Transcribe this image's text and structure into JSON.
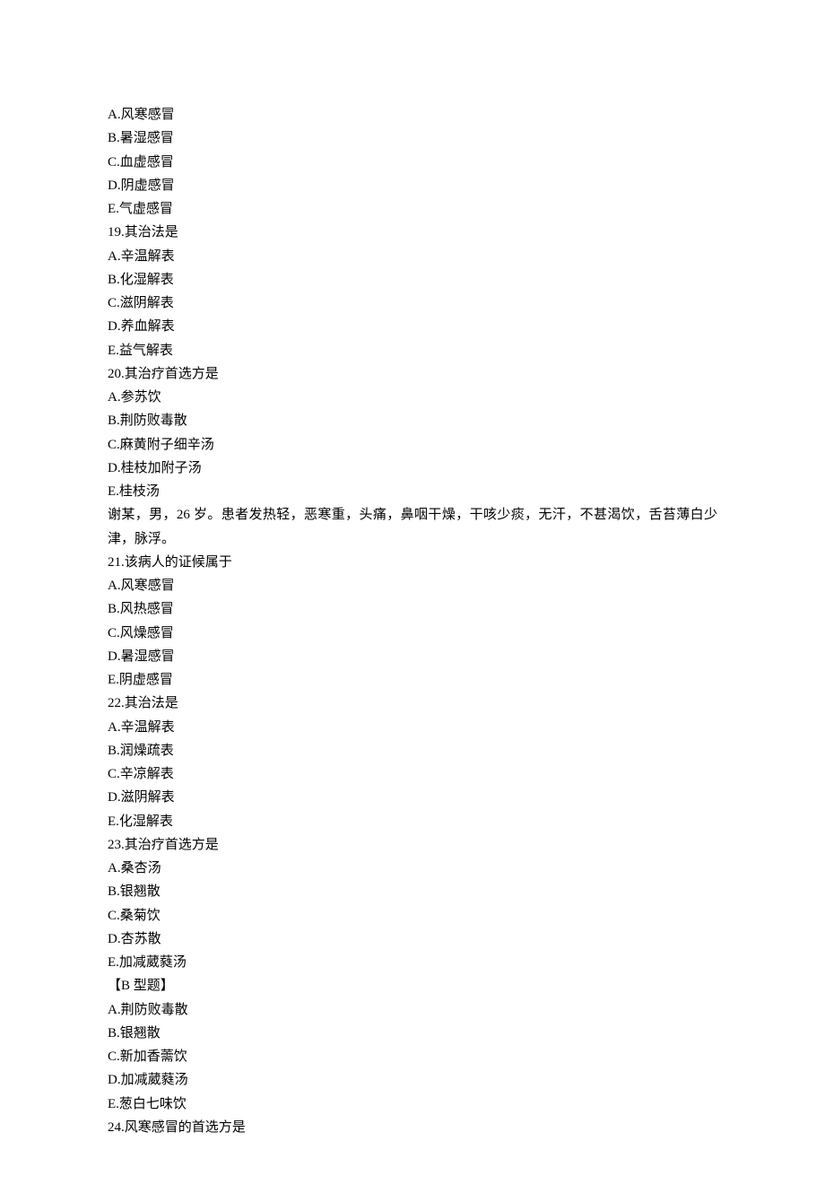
{
  "lines": [
    "A.风寒感冒",
    "B.暑湿感冒",
    "C.血虚感冒",
    "D.阴虚感冒",
    "E.气虚感冒",
    "19.其治法是",
    "A.辛温解表",
    "B.化湿解表",
    "C.滋阴解表",
    "D.养血解表",
    "E.益气解表",
    "20.其治疗首选方是",
    "A.参苏饮",
    "B.荆防败毒散",
    "C.麻黄附子细辛汤",
    "D.桂枝加附子汤",
    "E.桂枝汤",
    "谢某，男，26 岁。患者发热轻，恶寒重，头痛，鼻咽干燥，干咳少痰，无汗，不甚渴饮，舌苔薄白少津，脉浮。",
    "21.该病人的证候属于",
    "A.风寒感冒",
    "B.风热感冒",
    "C.风燥感冒",
    "D.暑湿感冒",
    "E.阴虚感冒",
    "22.其治法是",
    "A.辛温解表",
    "B.润燥疏表",
    "C.辛凉解表",
    "D.滋阴解表",
    "E.化湿解表",
    "23.其治疗首选方是",
    "A.桑杏汤",
    "B.银翘散",
    "C.桑菊饮",
    "D.杏苏散",
    "E.加减葳蕤汤",
    "【B 型题】",
    "A.荆防败毒散",
    "B.银翘散",
    "C.新加香薷饮",
    "D.加减葳蕤汤",
    "E.葱白七味饮",
    "24.风寒感冒的首选方是"
  ]
}
